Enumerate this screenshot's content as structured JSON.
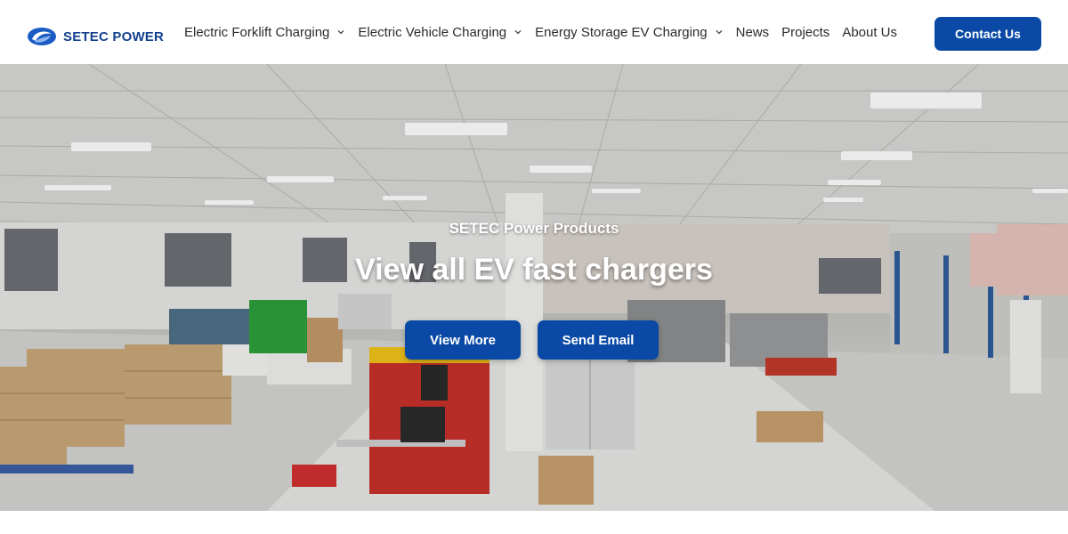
{
  "brand": {
    "name": "SETEC POWER",
    "color": "#14418f"
  },
  "nav": {
    "items": [
      {
        "label": "Electric Forklift Charging",
        "has_dropdown": true
      },
      {
        "label": "Electric Vehicle Charging",
        "has_dropdown": true
      },
      {
        "label": "Energy Storage EV Charging",
        "has_dropdown": true
      },
      {
        "label": "News",
        "has_dropdown": false
      },
      {
        "label": "Projects",
        "has_dropdown": false
      },
      {
        "label": "About Us",
        "has_dropdown": false
      }
    ],
    "contact_label": "Contact Us",
    "accent": "#0a4aa6"
  },
  "hero": {
    "subtitle": "SETEC Power Products",
    "title": "View all EV fast chargers",
    "buttons": {
      "view_more": "View More",
      "send_email": "Send Email"
    },
    "background": "factory-warehouse-photo"
  }
}
